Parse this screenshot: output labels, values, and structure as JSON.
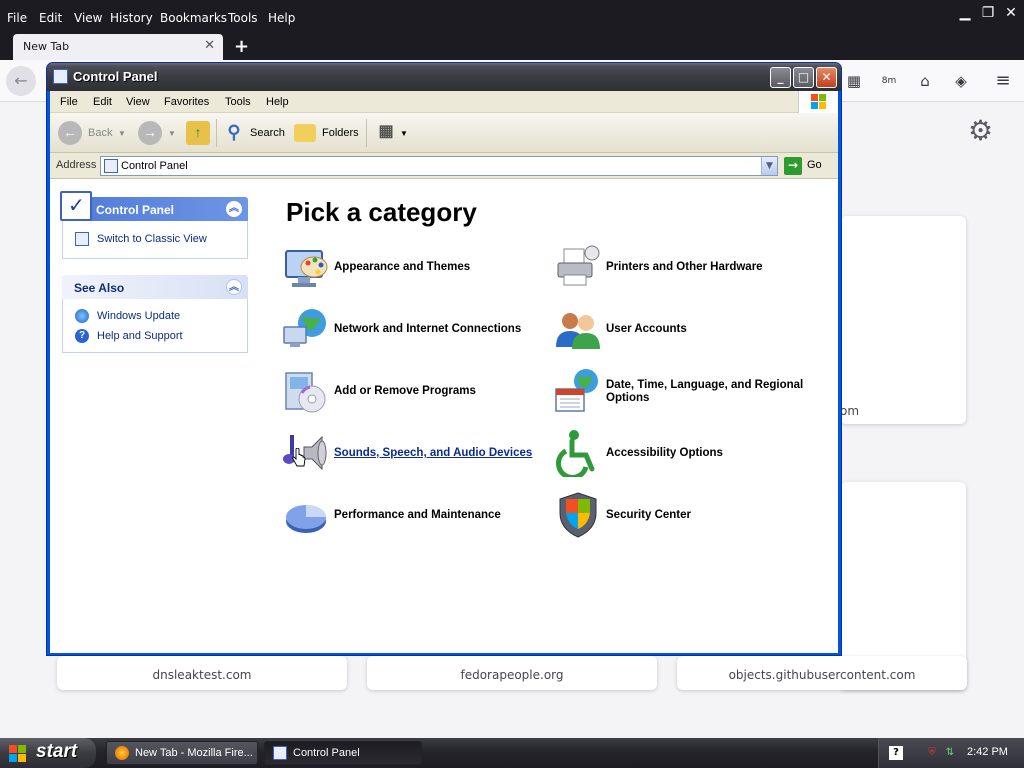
{
  "firefox": {
    "menu": [
      "File",
      "Edit",
      "View",
      "History",
      "Bookmarks",
      "Tools",
      "Help"
    ],
    "tab_title": "New Tab",
    "toolbar_badge": "8m",
    "tiles": [
      "dnsleaktest.com",
      "fedorapeople.org",
      "objects.githubusercontent.com"
    ],
    "partial_tile_text": "om"
  },
  "window": {
    "title": "Control Panel",
    "menu": [
      "File",
      "Edit",
      "View",
      "Favorites",
      "Tools",
      "Help"
    ],
    "toolbar": {
      "back": "Back",
      "search": "Search",
      "folders": "Folders"
    },
    "address": {
      "label": "Address",
      "value": "Control Panel",
      "go": "Go"
    },
    "task_pane": {
      "control_panel": {
        "heading": "Control Panel",
        "link": "Switch to Classic View"
      },
      "see_also": {
        "heading": "See Also",
        "links": [
          "Windows Update",
          "Help and Support"
        ]
      }
    },
    "main": {
      "title": "Pick a category",
      "categories_left": [
        {
          "label": "Appearance and Themes",
          "icon": "appearance-icon"
        },
        {
          "label": "Network and Internet Connections",
          "icon": "network-icon"
        },
        {
          "label": "Add or Remove Programs",
          "icon": "add-remove-programs-icon"
        },
        {
          "label": "Sounds, Speech, and Audio Devices",
          "icon": "sound-icon"
        },
        {
          "label": "Performance and Maintenance",
          "icon": "performance-icon"
        }
      ],
      "categories_right": [
        {
          "label": "Printers and Other Hardware",
          "icon": "printer-icon"
        },
        {
          "label": "User Accounts",
          "icon": "user-accounts-icon"
        },
        {
          "label_line1": "Date, Time, Language, and Regional",
          "label_line2": "Options",
          "icon": "date-time-icon"
        },
        {
          "label": "Accessibility Options",
          "icon": "accessibility-icon"
        },
        {
          "label": "Security Center",
          "icon": "security-shield-icon"
        }
      ]
    }
  },
  "taskbar": {
    "start": "start",
    "buttons": [
      "New Tab - Mozilla Fire...",
      "Control Panel"
    ],
    "tray_help": "?",
    "clock": "2:42 PM"
  }
}
